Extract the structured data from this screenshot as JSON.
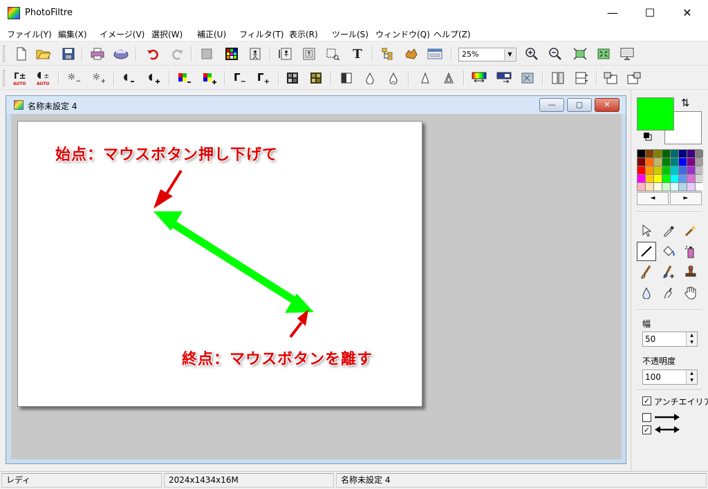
{
  "window": {
    "title": "PhotoFiltre",
    "minimize": "—",
    "maximize": "☐",
    "close": "✕"
  },
  "menu": [
    "ファイル(Y)",
    "編集(X)",
    "イメージ(V)",
    "選択(W)",
    "補正(U)",
    "フィルタ(T)",
    "表示(R)",
    "ツール(S)",
    "ウィンドウ(Q)",
    "ヘルプ(Z)"
  ],
  "toolbar": {
    "zoom_value": "25%",
    "row1_icons": [
      "new-icon",
      "open-icon",
      "save-icon",
      "print-icon",
      "scan-icon",
      "undo-icon",
      "redo-icon",
      "fill-selection-icon",
      "color-mode-icon",
      "transparent-icon",
      "image-size-icon",
      "canvas-size-icon",
      "crop-select-icon",
      "text-icon",
      "tree-icon",
      "filter-icon",
      "window-icon",
      "zoom-in-icon",
      "zoom-out-icon",
      "fit-icon",
      "actual-size-icon",
      "fullscreen-icon"
    ],
    "row2_icons": [
      "auto-levels-icon",
      "auto-contrast-icon",
      "brightness-minus-icon",
      "brightness-plus-icon",
      "contrast-minus-icon",
      "contrast-plus-icon",
      "saturation-minus-icon",
      "saturation-plus-icon",
      "gamma-minus-icon",
      "gamma-plus-icon",
      "grayscale-icon",
      "sepia-icon",
      "negative-icon",
      "blur-icon",
      "soften-icon",
      "sharpen-icon",
      "sharpen-more-icon",
      "gradient-icon",
      "gradient-dark-icon",
      "texture-icon",
      "flip-horizontal-icon",
      "flip-vertical-icon",
      "rotate-left-icon",
      "rotate-right-icon"
    ]
  },
  "document": {
    "title": "名称未設定 4",
    "min_label": "—",
    "restore_label": "▢",
    "close_label": "✕"
  },
  "annotations": {
    "start": "始点：マウスボタン押し下げて",
    "end": "終点：マウスボタンを離す"
  },
  "colors": {
    "foreground": "#00ff00",
    "background": "#ffffff",
    "arrow_green": "#00ff00",
    "annotation_red": "#e00000",
    "palette": [
      "#000000",
      "#7f3f00",
      "#7f7f00",
      "#006400",
      "#006b6b",
      "#00007f",
      "#3f007f",
      "#7f7f7f",
      "#7f0000",
      "#ff6a00",
      "#bdb76b",
      "#008000",
      "#008080",
      "#0000ff",
      "#800080",
      "#a0a0a0",
      "#ff0000",
      "#ff9900",
      "#cccc00",
      "#00c800",
      "#00c8c8",
      "#4169e1",
      "#9932cc",
      "#c0c0c0",
      "#ff00ff",
      "#ffcc00",
      "#ffff00",
      "#00ff00",
      "#00ffff",
      "#6495ed",
      "#da70d6",
      "#d8d8d8",
      "#ffb6c1",
      "#ffe4b5",
      "#ffffe0",
      "#ccffcc",
      "#e0ffff",
      "#add8e6",
      "#e6ccff",
      "#ffffff"
    ]
  },
  "right_panel": {
    "palette_prev": "◄",
    "palette_next": "►",
    "width_label": "幅",
    "width_value": "50",
    "opacity_label": "不透明度",
    "opacity_value": "100",
    "antialias_label": "アンチエイリア",
    "antialias_checked": "✓",
    "arrow_single_checked": "",
    "arrow_double_checked": "✓",
    "tools": [
      "select-arrow-icon",
      "eyedropper-icon",
      "magic-wand-icon",
      "line-icon",
      "fill-bucket-icon",
      "spray-icon",
      "brush-icon",
      "advanced-brush-icon",
      "stamp-icon",
      "blur-drop-icon",
      "smudge-icon",
      "hand-icon"
    ]
  },
  "status": {
    "state": "レディ",
    "image_info": "2024x1434x16M",
    "file_name": "名称未設定 4"
  }
}
